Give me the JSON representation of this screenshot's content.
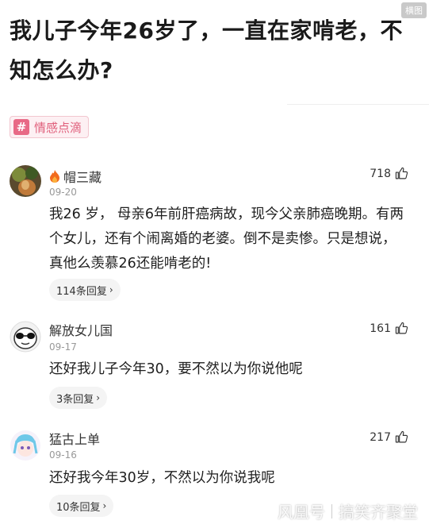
{
  "corner_badge": "横图",
  "article": {
    "title": "我儿子今年26岁了，一直在家啃老，不知怎么办?",
    "tag": "情感点滴"
  },
  "comments": [
    {
      "name": "帽三藏",
      "has_flame": true,
      "date": "09-20",
      "likes": "718",
      "body": "我26 岁， 母亲6年前肝癌病故，现今父亲肺癌晚期。有两个女儿，还有个闹离婚的老婆。倒不是卖惨。只是想说，真他么羡慕26还能啃老的!",
      "replies": "114条回复"
    },
    {
      "name": "解放女儿国",
      "has_flame": false,
      "date": "09-17",
      "likes": "161",
      "body": "还好我儿子今年30，要不然以为你说他呢",
      "replies": "3条回复"
    },
    {
      "name": "猛古上单",
      "has_flame": false,
      "date": "09-16",
      "likes": "217",
      "body": "还好我今年30岁，不然以为你说我呢",
      "replies": "10条回复"
    }
  ],
  "watermark": {
    "left": "风凰号",
    "right": "搞笑齐聚堂"
  },
  "colors": {
    "tag_accent": "#e86a86",
    "tag_text": "#e0607c",
    "flame": "#f26b1d"
  }
}
